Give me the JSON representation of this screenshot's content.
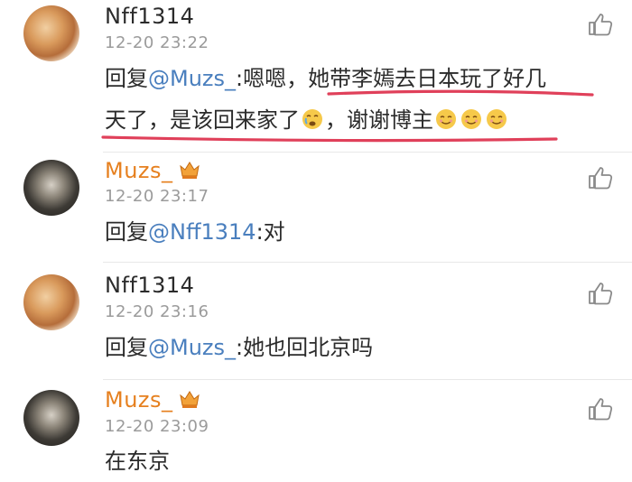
{
  "comments": [
    {
      "user": "Nff1314",
      "time": "12-20 23:22",
      "reply_prefix": "回复",
      "mention": "@Muzs_",
      "line1_rest": ":嗯嗯，她带李嫣去日本玩了好几",
      "line2": "天了，是该回来家了",
      "line2_tail": "，谢谢博主"
    },
    {
      "user": "Muzs_",
      "time": "12-20 23:17",
      "reply_prefix": "回复",
      "mention": "@Nff1314",
      "text_rest": ":对"
    },
    {
      "user": "Nff1314",
      "time": "12-20 23:16",
      "reply_prefix": "回复",
      "mention": "@Muzs_",
      "text_rest": ":她也回北京吗"
    },
    {
      "user": "Muzs_",
      "time": "12-20 23:09",
      "text": "在东京"
    }
  ],
  "colors": {
    "mention": "#4a7fbe",
    "vip_name": "#e6801f",
    "underline": "#e0405a"
  },
  "icons": {
    "like": "thumbs-up-icon",
    "badge": "crown-badge-icon",
    "emoji": "smile-emoji-icon"
  }
}
